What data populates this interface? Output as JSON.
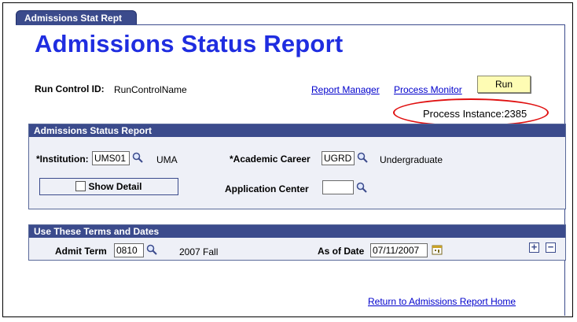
{
  "tab": {
    "label": "Admissions Stat Rept"
  },
  "page": {
    "title": "Admissions Status Report"
  },
  "run_control": {
    "label": "Run Control ID:",
    "value": "RunControlName"
  },
  "links": {
    "report_manager": "Report Manager",
    "process_monitor": "Process Monitor",
    "return_home": "Return to Admissions Report Home"
  },
  "run_button": {
    "label": "Run"
  },
  "process_instance": {
    "text": "Process Instance:2385"
  },
  "section1": {
    "header": "Admissions Status Report",
    "institution": {
      "label": "*Institution:",
      "value": "UMS01",
      "description": "UMA"
    },
    "academic_career": {
      "label": "*Academic Career",
      "value": "UGRD",
      "description": "Undergraduate"
    },
    "show_detail": {
      "label": "Show Detail"
    },
    "application_center": {
      "label": "Application Center",
      "value": ""
    }
  },
  "section2": {
    "header": "Use These Terms and Dates",
    "admit_term": {
      "label": "Admit Term",
      "value": "0810",
      "description": "2007 Fall"
    },
    "as_of_date": {
      "label": "As of Date",
      "value": "07/11/2007"
    },
    "add_symbol": "+",
    "remove_symbol": "−"
  },
  "colors": {
    "header_bg": "#3b4b8c",
    "title": "#1f2de0",
    "link": "#0000cc",
    "run_bg": "#fefcb4",
    "highlight": "#e01010"
  }
}
